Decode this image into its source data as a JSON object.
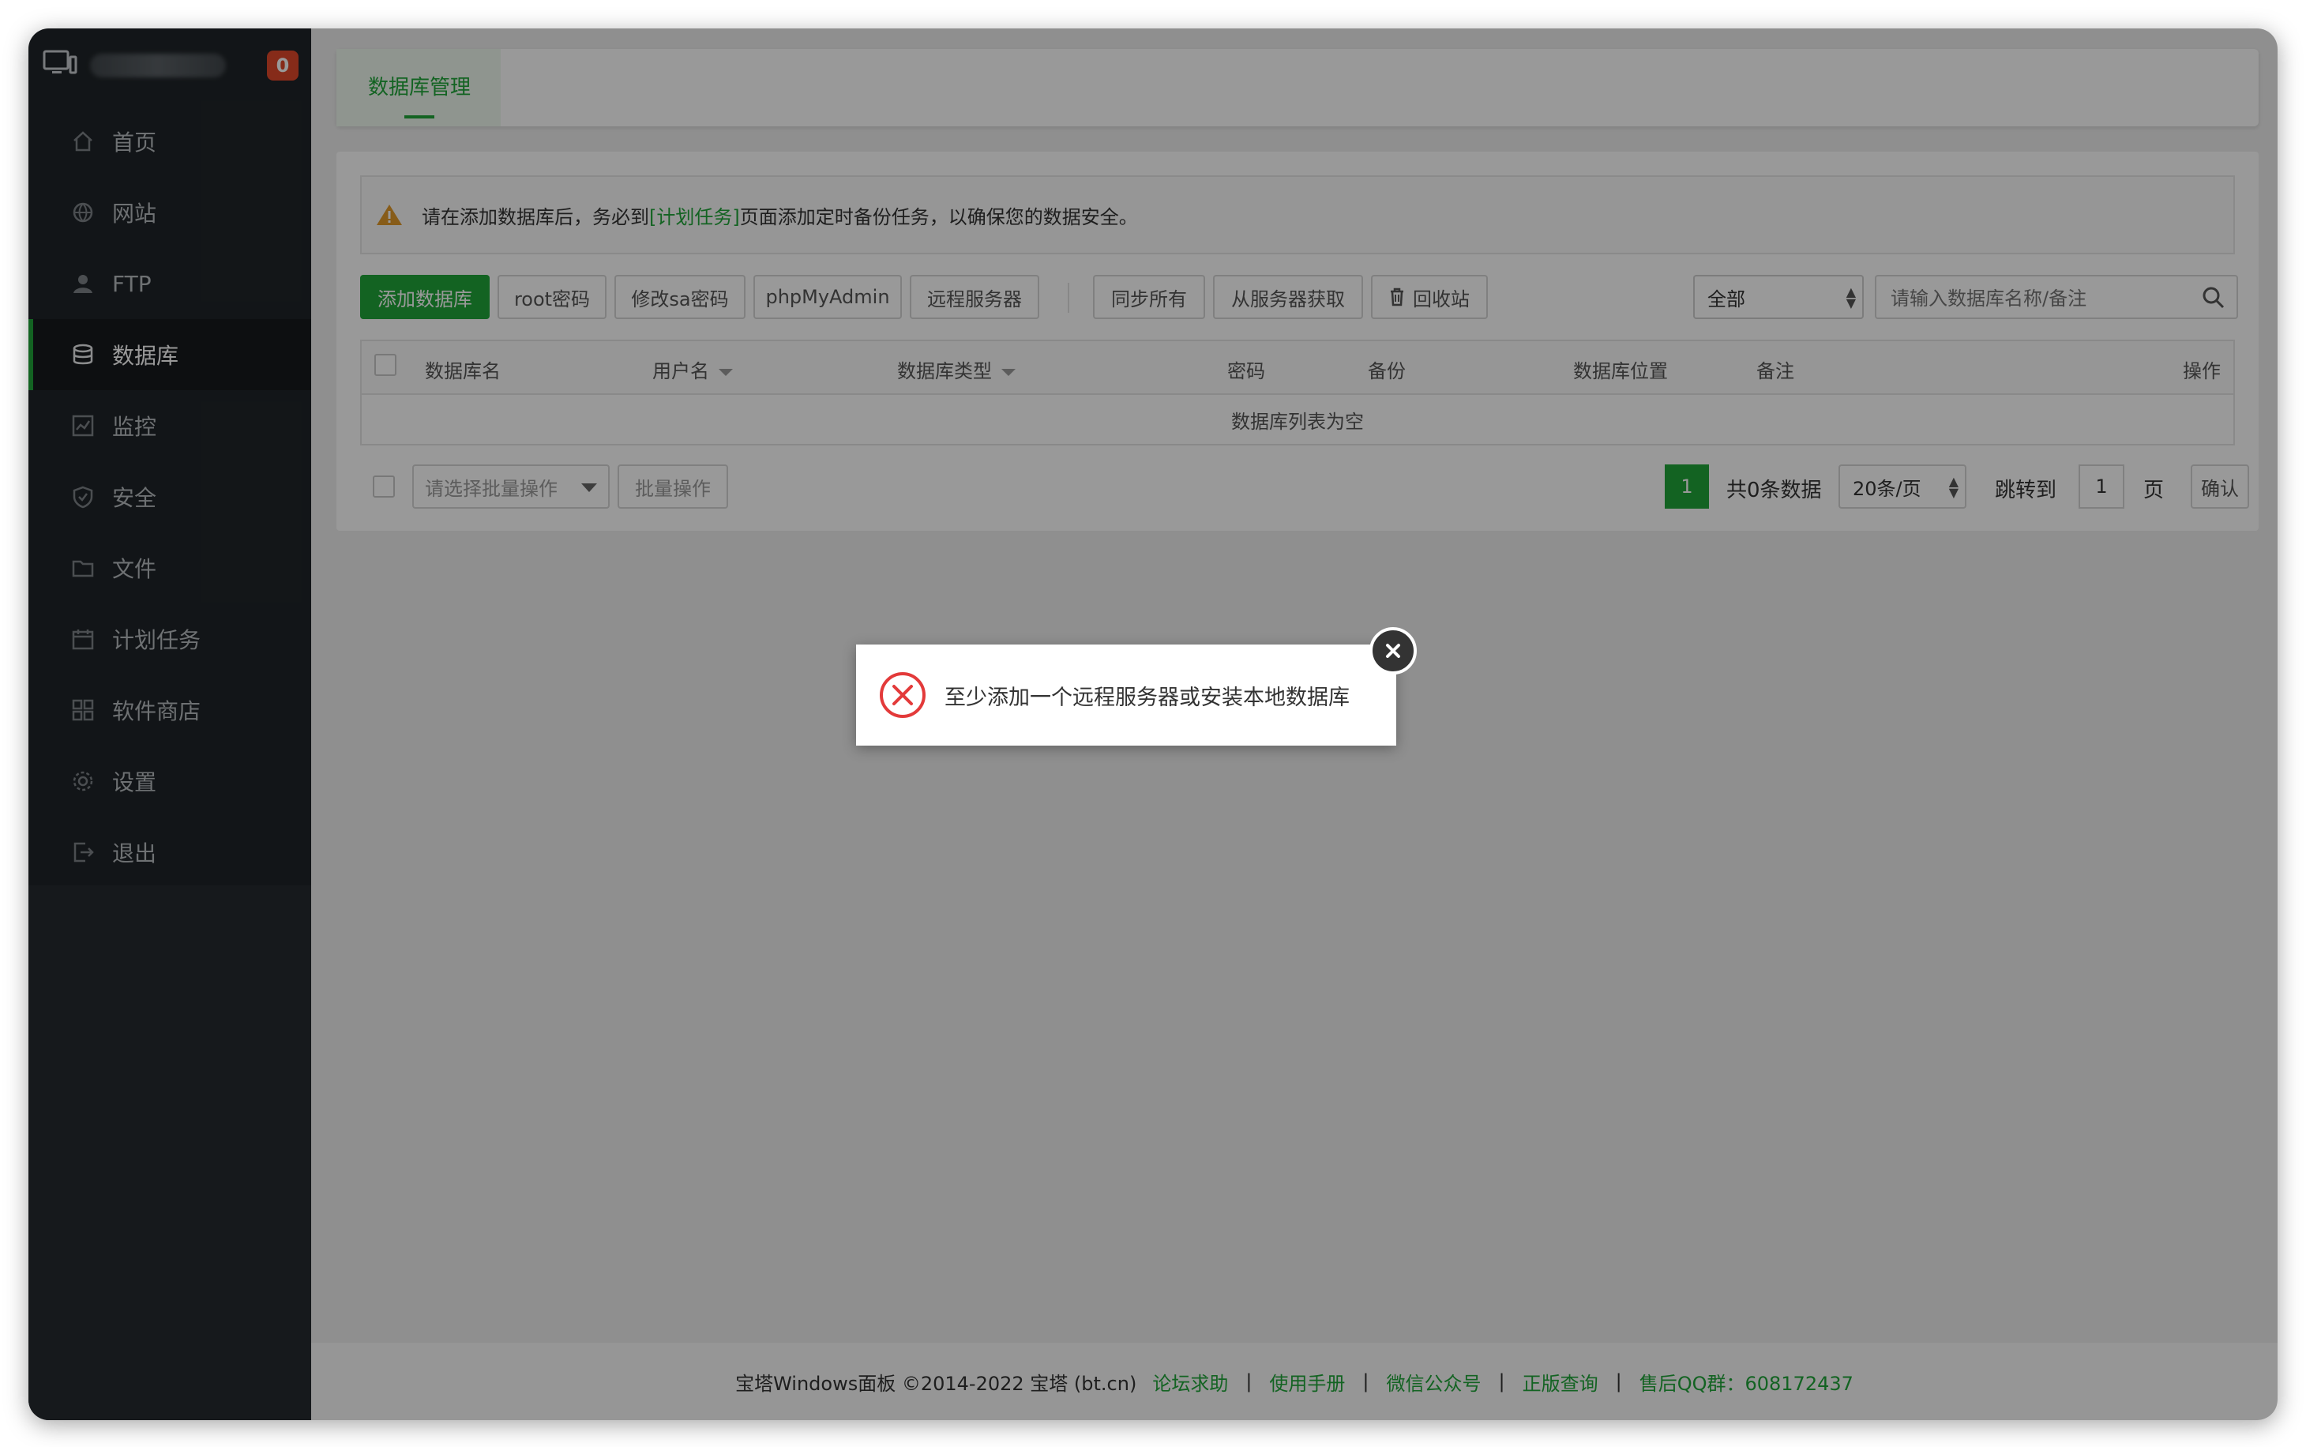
{
  "sidebar": {
    "badge_count": "0",
    "items": [
      {
        "label": "首页"
      },
      {
        "label": "网站"
      },
      {
        "label": "FTP"
      },
      {
        "label": "数据库"
      },
      {
        "label": "监控"
      },
      {
        "label": "安全"
      },
      {
        "label": "文件"
      },
      {
        "label": "计划任务"
      },
      {
        "label": "软件商店"
      },
      {
        "label": "设置"
      },
      {
        "label": "退出"
      }
    ],
    "active_index": 3
  },
  "tabs": [
    {
      "label": "数据库管理"
    }
  ],
  "alert": {
    "prefix": "请在添加数据库后，务必到",
    "link": "[计划任务]",
    "suffix": "页面添加定时备份任务，以确保您的数据安全。"
  },
  "toolbar": {
    "add_db": "添加数据库",
    "root_pwd": "root密码",
    "sa_pwd": "修改sa密码",
    "phpmyadmin": "phpMyAdmin",
    "remote_server": "远程服务器",
    "sync_all": "同步所有",
    "fetch_from_server": "从服务器获取",
    "recycle_bin": "回收站",
    "filter_value": "全部",
    "search_placeholder": "请输入数据库名称/备注"
  },
  "table": {
    "columns": [
      "数据库名",
      "用户名",
      "数据库类型",
      "密码",
      "备份",
      "数据库位置",
      "备注",
      "操作"
    ],
    "empty_text": "数据库列表为空"
  },
  "batch": {
    "placeholder": "请选择批量操作",
    "button": "批量操作"
  },
  "pagination": {
    "current_page": "1",
    "total_text": "共0条数据",
    "per_page": "20条/页",
    "jump_label": "跳转到",
    "jump_value": "1",
    "page_unit": "页",
    "confirm": "确认"
  },
  "footer": {
    "copyright": "宝塔Windows面板 ©2014-2022 宝塔 (bt.cn)",
    "links": [
      "论坛求助",
      "使用手册",
      "微信公众号",
      "正版查询",
      "售后QQ群：608172437"
    ]
  },
  "toast": {
    "message": "至少添加一个远程服务器或安装本地数据库"
  },
  "colors": {
    "accent": "#20a53a",
    "sidebar_bg": "#1f2428",
    "badge": "#e0482a",
    "error": "#e33a3a"
  }
}
